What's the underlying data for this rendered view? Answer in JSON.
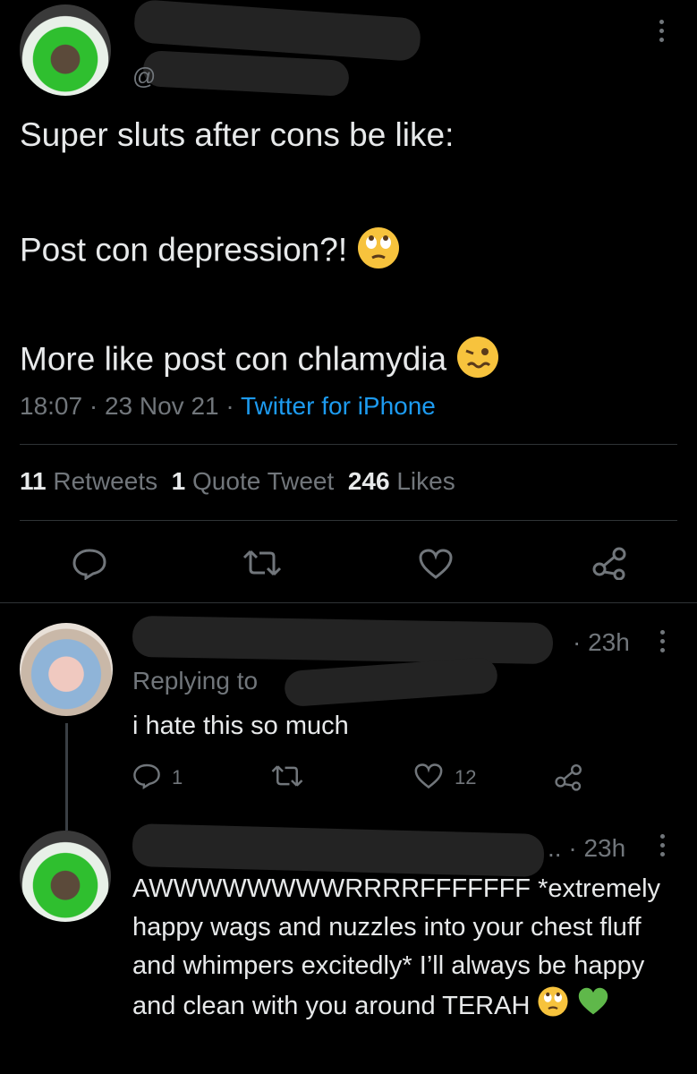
{
  "tweet": {
    "handle_prefix": "@",
    "line1": "Super sluts after cons be like:",
    "line2": "Post con depression?!",
    "line3": "More like post con chlamydia",
    "time": "18:07",
    "date": "23 Nov 21",
    "sep": "·",
    "source": "Twitter for iPhone",
    "stats": {
      "retweets_count": "11",
      "retweets_label": "Retweets",
      "quotes_count": "1",
      "quotes_label": "Quote Tweet",
      "likes_count": "246",
      "likes_label": "Likes"
    }
  },
  "replies": [
    {
      "time": "· 23h",
      "replying_to": "Replying to",
      "text": "i hate this so much",
      "reply_count": "1",
      "like_count": "12"
    },
    {
      "time": ".. · 23h",
      "text": "AWWWWWWWWRRRRFFFFFFF *extremely happy wags and nuzzles into your chest fluff and whimpers excitedly* I’ll always be happy and clean with you around TERAH"
    }
  ],
  "colors": {
    "accent": "#1d9bf0",
    "muted": "#71767b",
    "text": "#e7e9ea",
    "background": "#000000"
  },
  "icons": [
    "more-vertical-icon",
    "reply-icon",
    "retweet-icon",
    "like-icon",
    "share-icon",
    "eye-roll-emoji",
    "woozy-emoji",
    "green-heart-emoji"
  ]
}
